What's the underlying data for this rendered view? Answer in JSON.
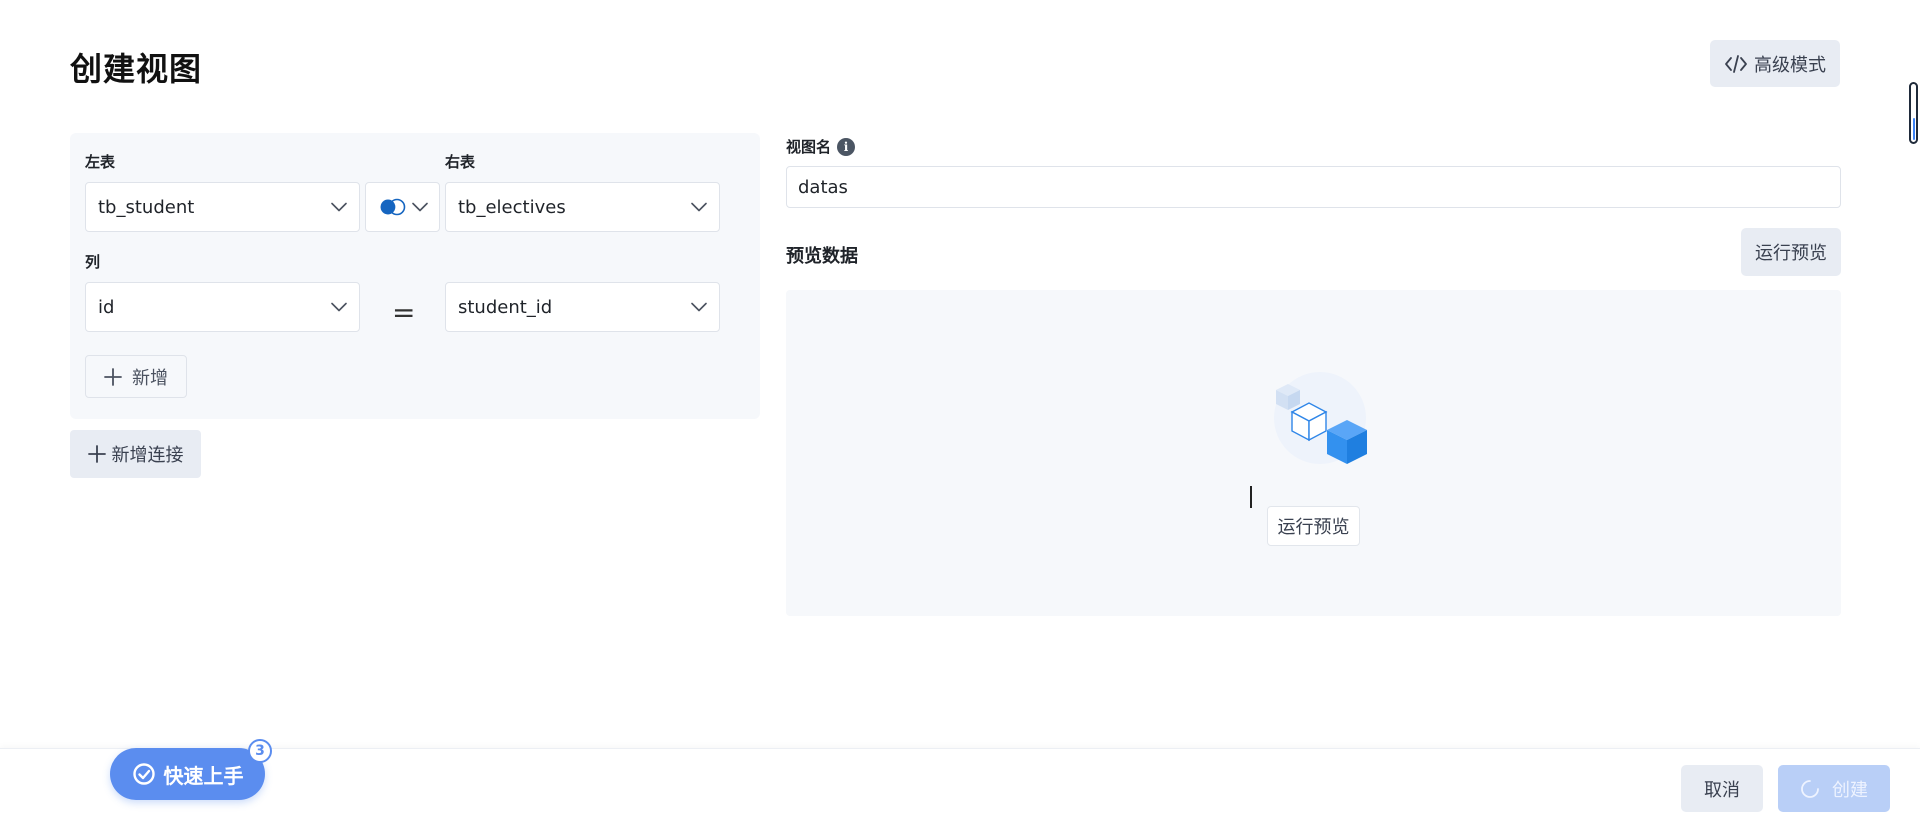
{
  "page": {
    "title": "创建视图",
    "advanced_mode_label": "高级模式"
  },
  "join": {
    "left_table_label": "左表",
    "right_table_label": "右表",
    "left_table_value": "tb_student",
    "right_table_value": "tb_electives",
    "join_type_icon": "inner-join-icon",
    "column_label": "列",
    "left_column_value": "id",
    "operator": "=",
    "right_column_value": "student_id",
    "add_label": "新增",
    "add_connection_label": "新增连接"
  },
  "view": {
    "name_label": "视图名",
    "name_value": "datas",
    "preview_label": "预览数据",
    "run_preview_label": "运行预览",
    "empty_run_preview_label": "运行预览"
  },
  "footer": {
    "quick_start_label": "快速上手",
    "quick_start_badge": "3",
    "cancel_label": "取消",
    "create_label": "创建"
  },
  "colors": {
    "accent": "#5b8def",
    "disabled_primary": "#b9cff7",
    "secondary_button": "#e8ecf3",
    "panel_bg": "#f6f8fb"
  }
}
